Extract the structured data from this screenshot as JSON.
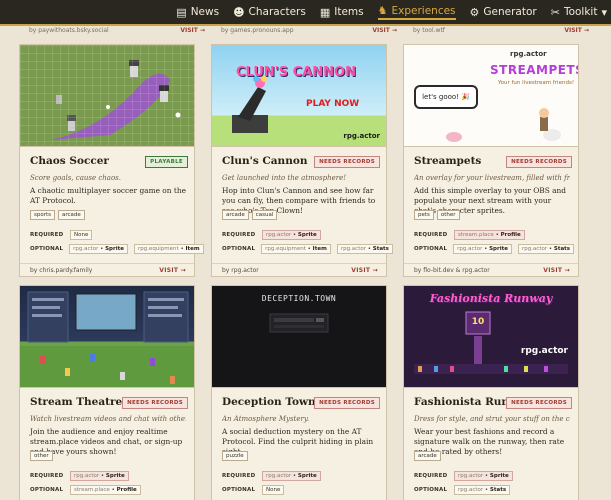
{
  "nav": {
    "items": [
      {
        "label": "News",
        "icon": "newspaper-icon",
        "glyph": "▤"
      },
      {
        "label": "Characters",
        "icon": "characters-icon",
        "glyph": "☻"
      },
      {
        "label": "Items",
        "icon": "items-icon",
        "glyph": "▦"
      },
      {
        "label": "Experiences",
        "icon": "experiences-icon",
        "glyph": "♞",
        "active": true
      },
      {
        "label": "Generator",
        "icon": "generator-icon",
        "glyph": "⚙"
      },
      {
        "label": "Toolkit",
        "icon": "toolkit-icon",
        "glyph": "✂"
      }
    ]
  },
  "previous_row": [
    {
      "author": "by paywithoats.bsky.social",
      "visit": "VISIT →"
    },
    {
      "author": "by games.pronouns.app",
      "visit": "VISIT →"
    },
    {
      "author": "by tool.wtf",
      "visit": "VISIT →"
    }
  ],
  "labels": {
    "required": "REQUIRED",
    "optional": "OPTIONAL",
    "visit": "VISIT →"
  },
  "cards": [
    {
      "title": "Chaos Soccer",
      "badge": "PLAYABLE",
      "badge_type": "playable",
      "tagline": "Score goals, cause chaos.",
      "description": "A chaotic multiplayer soccer game on the AT Protocol.",
      "tags": [
        "sports",
        "arcade"
      ],
      "required": [
        {
          "text": "None"
        }
      ],
      "optional": [
        {
          "domain": "rpg.actor",
          "record": "Sprite"
        },
        {
          "domain": "rpg.equipment",
          "record": "Item"
        }
      ],
      "author": "by chris.pardy.family"
    },
    {
      "title": "Clun's Cannon",
      "badge": "NEEDS RECORDS",
      "badge_type": "needs",
      "tagline": "Get launched into the atmosphere!",
      "description": "Hop into Clun's Cannon and see how far you can fly, then compare with friends to see who's Top Clown!",
      "tags": [
        "arcade",
        "casual"
      ],
      "required": [
        {
          "domain": "rpg.actor",
          "record": "Sprite"
        }
      ],
      "optional": [
        {
          "domain": "rpg.equipment",
          "record": "Item"
        },
        {
          "domain": "rpg.actor",
          "record": "Stats"
        }
      ],
      "author": "by rpg.actor",
      "thumb": {
        "title": "CLUN'S CANNON",
        "cta": "PLAY NOW",
        "brand": "rpg.actor"
      }
    },
    {
      "title": "Streampets",
      "badge": "NEEDS RECORDS",
      "badge_type": "needs",
      "tagline": "An overlay for your livestream, filled with friends!",
      "description": "Add this simple overlay to your OBS and populate your next stream with your chat's character sprites.",
      "tags": [
        "pets",
        "other"
      ],
      "required": [
        {
          "domain": "stream.place",
          "record": "Profile"
        }
      ],
      "optional": [
        {
          "domain": "rpg.actor",
          "record": "Sprite"
        },
        {
          "domain": "rpg.actor",
          "record": "Stats"
        }
      ],
      "author": "by flo-bit.dev & rpg.actor",
      "thumb": {
        "brand": "rpg.actor",
        "title": "STREAMPETS",
        "subtitle": "Your fun livestream friends!",
        "bubble": "let's gooo! 🎉"
      }
    },
    {
      "title": "Stream Theatre",
      "badge": "NEEDS RECORDS",
      "badge_type": "needs",
      "tagline": "Watch livestream videos and chat with other viewers",
      "description": "Join the audience and enjoy realtime stream.place videos and chat, or sign-up and have yours shown!",
      "tags": [
        "other"
      ],
      "required": [
        {
          "domain": "rpg.actor",
          "record": "Sprite"
        }
      ],
      "optional": [
        {
          "domain": "stream.place",
          "record": "Profile"
        }
      ],
      "author": ""
    },
    {
      "title": "Deception Town",
      "badge": "NEEDS RECORDS",
      "badge_type": "needs",
      "tagline": "An Atmosphere Mystery.",
      "description": "A social deduction mystery on the AT Protocol. Find the culprit hiding in plain sight.",
      "tags": [
        "puzzle"
      ],
      "required": [
        {
          "domain": "rpg.actor",
          "record": "Sprite"
        }
      ],
      "optional": [
        {
          "text": "None"
        }
      ],
      "author": "",
      "thumb": {
        "title": "DECEPTION.TOWN"
      }
    },
    {
      "title": "Fashionista Runway",
      "badge": "NEEDS RECORDS",
      "badge_type": "needs",
      "tagline": "Dress for style, and strut your stuff on the catwalk",
      "description": "Wear your best fashions and record a signature walk on the runway, then rate and be rated by others!",
      "tags": [
        "arcade"
      ],
      "required": [
        {
          "domain": "rpg.actor",
          "record": "Sprite"
        }
      ],
      "optional": [
        {
          "domain": "rpg.actor",
          "record": "Stats"
        }
      ],
      "author": "",
      "thumb": {
        "title": "Fashionista Runway",
        "brand": "rpg.actor",
        "score": "10"
      }
    }
  ],
  "colors": {
    "nav_bg": "#2a2620",
    "accent": "#d9a93f",
    "page_bg": "#ece5d6",
    "visit": "#9c3b2f",
    "playable": "#3b7a3b",
    "needs": "#9c3b2f"
  }
}
